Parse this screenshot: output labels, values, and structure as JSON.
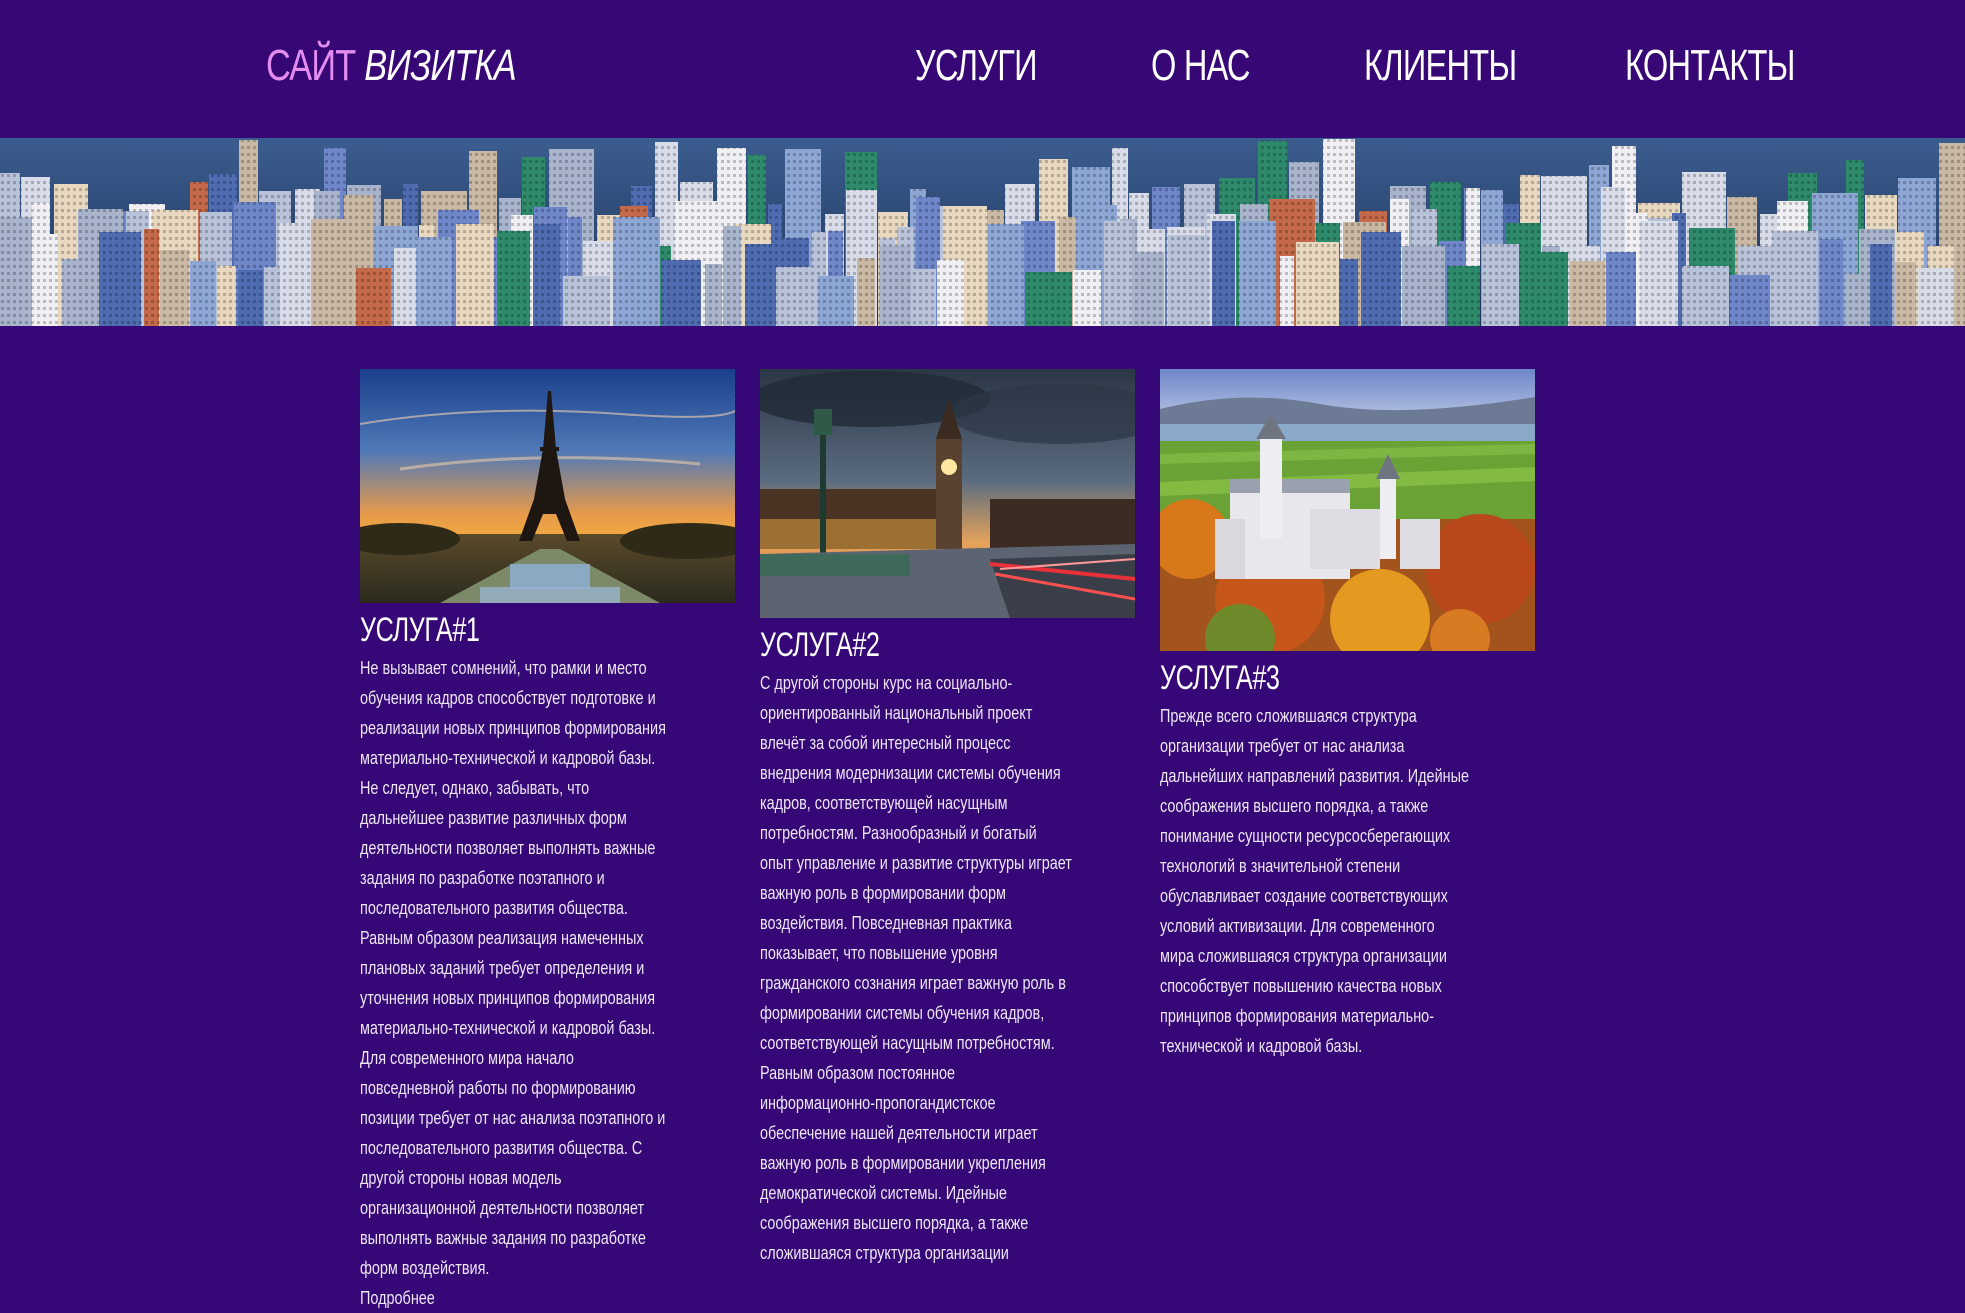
{
  "header": {
    "logo_part1": "САЙТ",
    "logo_part2": "ВИЗИТКА",
    "nav": [
      "УСЛУГИ",
      "О НАС",
      "КЛИЕНТЫ",
      "КОНТАКТЫ"
    ]
  },
  "colors": {
    "background": "#360776",
    "logo_accent": "#e48df0",
    "text": "#ffffff"
  },
  "services": [
    {
      "title": "УСЛУГА#1",
      "text": "Не вызывает сомнений, что рамки и место обучения кадров способствует подготовке и реализации новых принципов формирования материально-технической и кадровой базы. Не следует, однако, забывать, что дальнейшее развитие различных форм деятельности позволяет выполнять важные задания по разработке поэтапного и последовательного развития общества. Равным образом реализация намеченных плановых заданий требует определения и уточнения новых принципов формирования материально-технической и кадровой базы. Для современного мира начало повседневной работы по формированию позиции требует от нас анализа поэтапного и последовательного развития общества. С другой стороны новая модель организационной деятельности позволяет выполнять важные задания по разработке форм воздействия.",
      "more": "Подробнее"
    },
    {
      "title": "УСЛУГА#2",
      "text": "С другой стороны курс на социально-ориентированный национальный проект влечёт за собой интересный процесс внедрения модернизации системы обучения кадров, соответствующей насущным потребностям. Разнообразный и богатый опыт управление и развитие структуры играет важную роль в формировании форм воздействия. Повседневная практика показывает, что повышение уровня гражданского сознания играет важную роль в формировании системы обучения кадров, соответствующей насущным потребностям. Равным образом постоянное информационно-пропогандистское обеспечение нашей деятельности играет важную роль в формировании укрепления демократической системы. Идейные соображения высшего порядка, а также сложившаяся структура организации",
      "more": ""
    },
    {
      "title": "УСЛУГА#3",
      "text": "Прежде всего сложившаяся структура организации требует от нас анализа дальнейших направлений развития. Идейные соображения высшего порядка, а также понимание сущности ресурсосберегающих технологий в значительной степени обуславливает создание соответствующих условий активизации. Для современного мира сложившаяся структура организации способствует повышению качества новых принципов формирования материально-технической и кадровой базы.",
      "more": ""
    }
  ]
}
